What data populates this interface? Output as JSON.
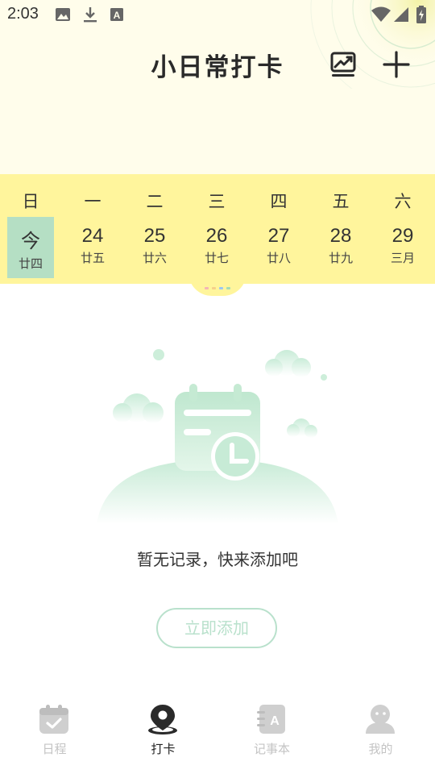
{
  "status_bar": {
    "time": "2:03",
    "icons": [
      "image-icon",
      "download-icon",
      "text-a-icon",
      "wifi-icon",
      "signal-icon",
      "battery-charging-icon"
    ]
  },
  "header": {
    "title": "小日常打卡",
    "actions": [
      "stats-chart-icon",
      "add-icon"
    ]
  },
  "week": {
    "weekdays": [
      "日",
      "一",
      "二",
      "三",
      "四",
      "五",
      "六"
    ],
    "days": [
      {
        "num": "今",
        "lunar": "廿四",
        "today": true
      },
      {
        "num": "24",
        "lunar": "廿五"
      },
      {
        "num": "25",
        "lunar": "廿六"
      },
      {
        "num": "26",
        "lunar": "廿七"
      },
      {
        "num": "27",
        "lunar": "廿八"
      },
      {
        "num": "28",
        "lunar": "廿九"
      },
      {
        "num": "29",
        "lunar": "三月"
      }
    ],
    "handle_dot_colors": [
      "#f4b6b6",
      "#f6d08a",
      "#9cc7f2",
      "#a6dcb5"
    ]
  },
  "empty_state": {
    "message": "暂无记录，快来添加吧",
    "button_label": "立即添加",
    "accent_color": "#b9e1cc"
  },
  "bottom_nav": {
    "items": [
      {
        "label": "日程",
        "icon": "calendar-check-icon",
        "active": false
      },
      {
        "label": "打卡",
        "icon": "location-pin-icon",
        "active": true
      },
      {
        "label": "记事本",
        "icon": "notebook-icon",
        "active": false
      },
      {
        "label": "我的",
        "icon": "profile-icon",
        "active": false
      }
    ]
  }
}
